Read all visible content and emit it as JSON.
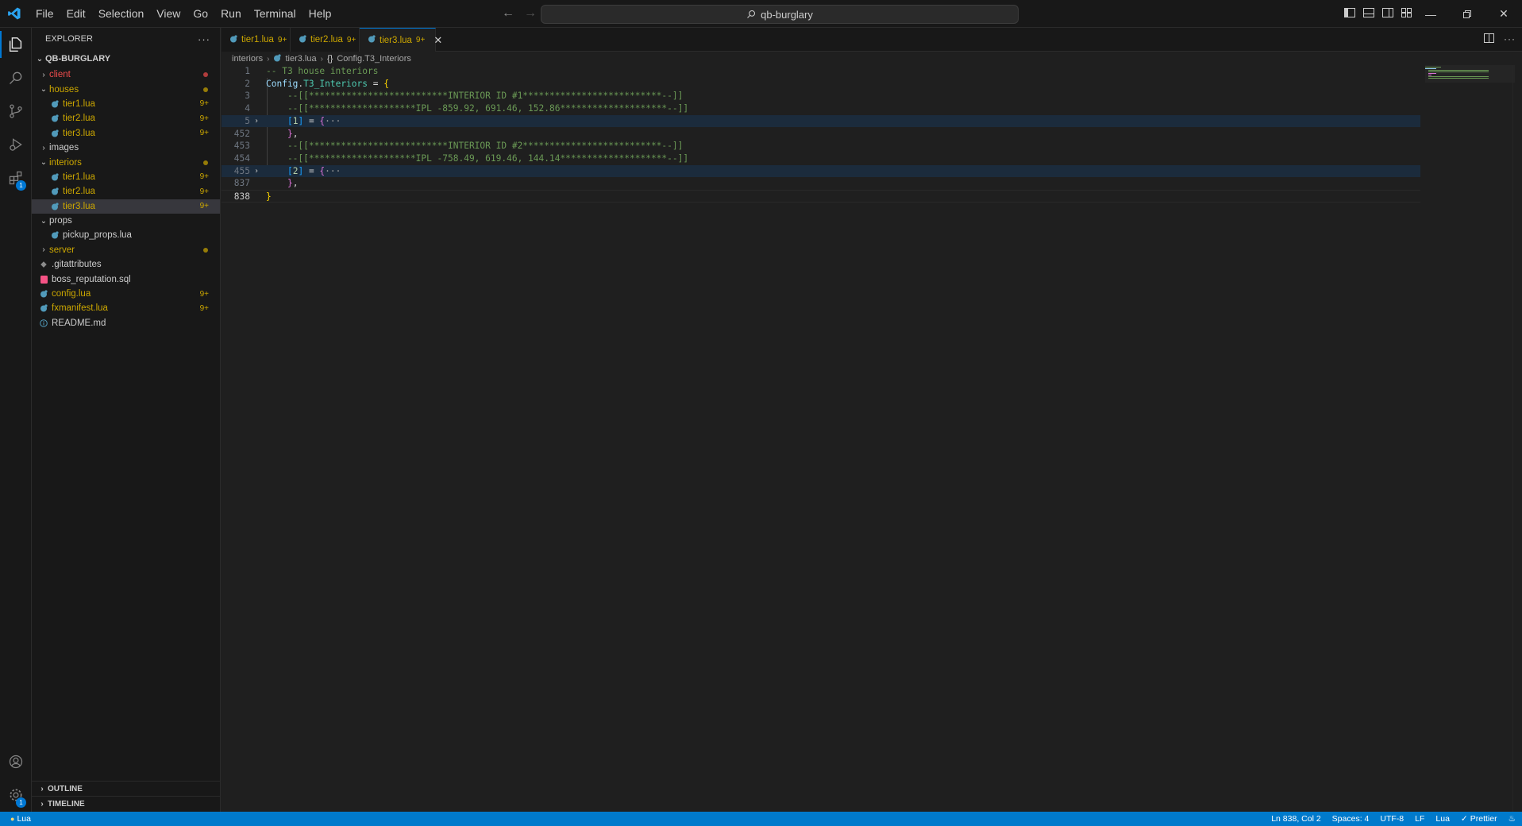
{
  "titlebar": {
    "menu": [
      "File",
      "Edit",
      "Selection",
      "View",
      "Go",
      "Run",
      "Terminal",
      "Help"
    ],
    "search_text": "qb-burglary"
  },
  "sidebar": {
    "title": "EXPLORER",
    "more": "···",
    "root": "QB-BURGLARY",
    "items": [
      {
        "label": "client",
        "type": "folder",
        "expanded": false,
        "depth": 0,
        "color": "#f14c4c",
        "dot": "#f14c4c"
      },
      {
        "label": "houses",
        "type": "folder",
        "expanded": true,
        "depth": 0,
        "color": "#cca700",
        "dot": "#cca700"
      },
      {
        "label": "tier1.lua",
        "type": "lua",
        "depth": 1,
        "color": "#cca700",
        "badge": "9+"
      },
      {
        "label": "tier2.lua",
        "type": "lua",
        "depth": 1,
        "color": "#cca700",
        "badge": "9+"
      },
      {
        "label": "tier3.lua",
        "type": "lua",
        "depth": 1,
        "color": "#cca700",
        "badge": "9+"
      },
      {
        "label": "images",
        "type": "folder",
        "expanded": false,
        "depth": 0,
        "color": "#cccccc"
      },
      {
        "label": "interiors",
        "type": "folder",
        "expanded": true,
        "depth": 0,
        "color": "#cca700",
        "dot": "#cca700"
      },
      {
        "label": "tier1.lua",
        "type": "lua",
        "depth": 1,
        "color": "#cca700",
        "badge": "9+"
      },
      {
        "label": "tier2.lua",
        "type": "lua",
        "depth": 1,
        "color": "#cca700",
        "badge": "9+"
      },
      {
        "label": "tier3.lua",
        "type": "lua",
        "depth": 1,
        "color": "#cca700",
        "badge": "9+",
        "selected": true
      },
      {
        "label": "props",
        "type": "folder",
        "expanded": true,
        "depth": 0,
        "color": "#cccccc"
      },
      {
        "label": "pickup_props.lua",
        "type": "lua",
        "depth": 1,
        "color": "#cccccc"
      },
      {
        "label": "server",
        "type": "folder",
        "expanded": false,
        "depth": 0,
        "color": "#cca700",
        "dot": "#cca700"
      },
      {
        "label": ".gitattributes",
        "type": "git",
        "depth": 0,
        "color": "#cccccc"
      },
      {
        "label": "boss_reputation.sql",
        "type": "sql",
        "depth": 0,
        "color": "#cccccc"
      },
      {
        "label": "config.lua",
        "type": "lua",
        "depth": 0,
        "color": "#cca700",
        "badge": "9+"
      },
      {
        "label": "fxmanifest.lua",
        "type": "lua",
        "depth": 0,
        "color": "#cca700",
        "badge": "9+"
      },
      {
        "label": "README.md",
        "type": "info",
        "depth": 0,
        "color": "#cccccc"
      }
    ],
    "outline": "OUTLINE",
    "timeline": "TIMELINE"
  },
  "tabs": [
    {
      "label": "tier1.lua",
      "badge": "9+",
      "active": false
    },
    {
      "label": "tier2.lua",
      "badge": "9+",
      "active": false
    },
    {
      "label": "tier3.lua",
      "badge": "9+",
      "active": true
    }
  ],
  "breadcrumb": {
    "folder": "interiors",
    "file": "tier3.lua",
    "symbol": "Config.T3_Interiors"
  },
  "editor": {
    "lines": [
      {
        "num": "1",
        "tokens": [
          [
            "-- T3 house interiors",
            "comment"
          ]
        ]
      },
      {
        "num": "2",
        "tokens": [
          [
            "Config",
            "var"
          ],
          [
            ".",
            "op"
          ],
          [
            "T3_Interiors",
            "fn"
          ],
          [
            " = ",
            "op"
          ],
          [
            "{",
            "brace"
          ]
        ]
      },
      {
        "num": "3",
        "tokens": [
          [
            "    --[[**************************INTERIOR ID #1**************************--]]",
            "comment"
          ]
        ]
      },
      {
        "num": "4",
        "tokens": [
          [
            "    --[[********************IPL -859.92, 691.46, 152.86********************--]]",
            "comment"
          ]
        ]
      },
      {
        "num": "5",
        "fold": true,
        "highlight": true,
        "tokens": [
          [
            "    ",
            "op"
          ],
          [
            "[",
            "brack"
          ],
          [
            "1",
            "num"
          ],
          [
            "]",
            "brack"
          ],
          [
            " = ",
            "op"
          ],
          [
            "{",
            "brace2"
          ],
          [
            "···",
            "ell"
          ]
        ]
      },
      {
        "num": "452",
        "tokens": [
          [
            "    ",
            "op"
          ],
          [
            "}",
            "brace2"
          ],
          [
            ",",
            "op"
          ]
        ]
      },
      {
        "num": "453",
        "tokens": [
          [
            "    --[[**************************INTERIOR ID #2**************************--]]",
            "comment"
          ]
        ]
      },
      {
        "num": "454",
        "tokens": [
          [
            "    --[[********************IPL -758.49, 619.46, 144.14********************--]]",
            "comment"
          ]
        ]
      },
      {
        "num": "455",
        "fold": true,
        "highlight": true,
        "tokens": [
          [
            "    ",
            "op"
          ],
          [
            "[",
            "brack"
          ],
          [
            "2",
            "num"
          ],
          [
            "]",
            "brack"
          ],
          [
            " = ",
            "op"
          ],
          [
            "{",
            "brace2"
          ],
          [
            "···",
            "ell"
          ]
        ]
      },
      {
        "num": "837",
        "tokens": [
          [
            "    ",
            "op"
          ],
          [
            "}",
            "brace2"
          ],
          [
            ",",
            "op"
          ]
        ]
      },
      {
        "num": "838",
        "current": true,
        "tokens": [
          [
            "}",
            "brace"
          ]
        ]
      }
    ]
  },
  "statusbar": {
    "language_left": "Lua",
    "position": "Ln 838, Col 2",
    "spaces": "Spaces: 4",
    "encoding": "UTF-8",
    "eol": "LF",
    "language": "Lua",
    "prettier": "Prettier"
  },
  "colors": {
    "accent": "#0078d4",
    "statusbar": "#007acc",
    "warning": "#cca700",
    "error": "#f14c4c"
  }
}
